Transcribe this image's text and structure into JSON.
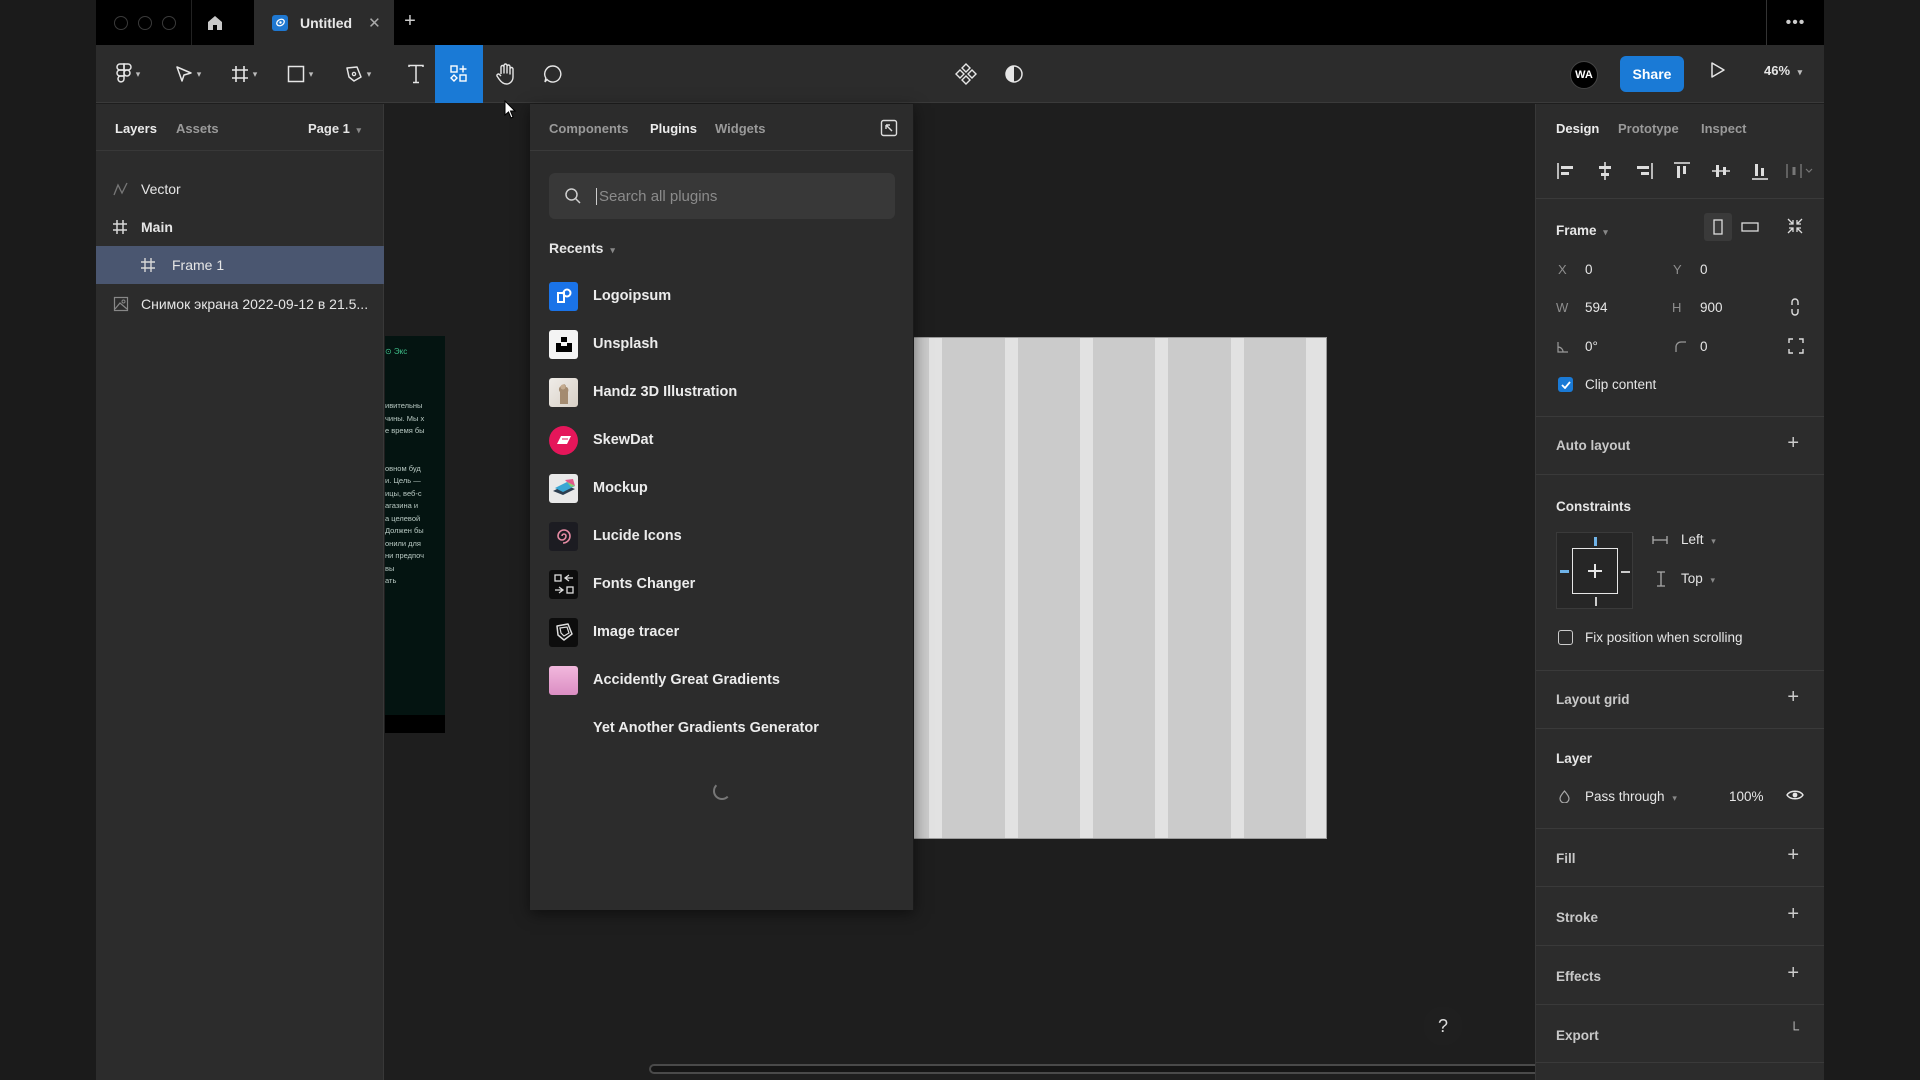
{
  "titlebar": {
    "tab_title": "Untitled",
    "close_symbol": "✕",
    "new_tab_symbol": "+",
    "more_symbol": "•••"
  },
  "toolbar": {
    "tools": [
      {
        "name": "main-menu",
        "icon": "figma-logo-icon",
        "has_dropdown": true
      },
      {
        "name": "move-tool",
        "icon": "cursor-icon",
        "has_dropdown": true
      },
      {
        "name": "frame-tool",
        "icon": "frame-icon",
        "has_dropdown": true
      },
      {
        "name": "shape-tool",
        "icon": "rectangle-icon",
        "has_dropdown": true
      },
      {
        "name": "pen-tool",
        "icon": "pen-icon",
        "has_dropdown": true
      },
      {
        "name": "text-tool",
        "icon": "text-icon",
        "has_dropdown": false
      },
      {
        "name": "resources-tool",
        "icon": "resources-icon",
        "active": true
      },
      {
        "name": "hand-tool",
        "icon": "hand-icon",
        "has_dropdown": false
      },
      {
        "name": "comment-tool",
        "icon": "comment-icon",
        "has_dropdown": false
      }
    ],
    "center_icons": [
      "component-icon",
      "contrast-icon"
    ],
    "avatar_initials": "WA",
    "share_label": "Share",
    "zoom_level": "46%",
    "accent_color": "#1a7ad6"
  },
  "left_panel": {
    "tabs": [
      "Layers",
      "Assets"
    ],
    "page_selector": "Page 1",
    "layers": [
      {
        "name": "Vector",
        "icon": "vector-icon",
        "indent": 0,
        "selected": false
      },
      {
        "name": "Main",
        "icon": "frame-icon",
        "indent": 0,
        "selected": false
      },
      {
        "name": "Frame 1",
        "icon": "frame-icon",
        "indent": 1,
        "selected": true
      },
      {
        "name": "Снимок экрана 2022-09-12 в 21.5...",
        "icon": "image-icon",
        "indent": 0,
        "selected": false
      }
    ]
  },
  "canvas": {
    "thumbnail_lines": [
      "ивительны",
      "чины. Мы х",
      "е время бы",
      "",
      "",
      "овном буд",
      "и. Цель —",
      "ицы, веб-с",
      "агазина и",
      "а целевой",
      "Должен бы",
      "онили для",
      "ни предпоч",
      "вы",
      "ать"
    ],
    "thumbnail_badge": "⊙ Экс",
    "frame_grid_columns": 6
  },
  "plugins_panel": {
    "tabs": [
      "Components",
      "Plugins",
      "Widgets"
    ],
    "active_tab": "Plugins",
    "search_placeholder": "Search all plugins",
    "search_value": "",
    "section_label": "Recents",
    "plugins": [
      {
        "name": "Logoipsum",
        "icon": "logoipsum-icon",
        "color": "#1a73e8"
      },
      {
        "name": "Unsplash",
        "icon": "unsplash-icon",
        "color": "#ffffff"
      },
      {
        "name": "Handz 3D Illustration",
        "icon": "handz-icon",
        "color": "#e8e4df"
      },
      {
        "name": "SkewDat",
        "icon": "skewdat-icon",
        "color": "#e5165a"
      },
      {
        "name": "Mockup",
        "icon": "mockup-icon",
        "color": "#e8e8e8"
      },
      {
        "name": "Lucide Icons",
        "icon": "lucide-icon",
        "color": "#1c1c22"
      },
      {
        "name": "Fonts Changer",
        "icon": "fonts-changer-icon",
        "color": "#0d0d0d"
      },
      {
        "name": "Image tracer",
        "icon": "image-tracer-icon",
        "color": "#0d0d0d"
      },
      {
        "name": "Accidently Great Gradients",
        "icon": "gradient-icon",
        "color": "#e6a3cf"
      },
      {
        "name": "Yet Another Gradients Generator",
        "icon": "gradients-generator-icon",
        "color": "#1a5fd6"
      }
    ]
  },
  "right_panel": {
    "tabs": [
      "Design",
      "Prototype",
      "Inspect"
    ],
    "active_tab": "Design",
    "frame": {
      "label": "Frame",
      "x_label": "X",
      "x": "0",
      "y_label": "Y",
      "y": "0",
      "w_label": "W",
      "w": "594",
      "h_label": "H",
      "h": "900",
      "rotation": "0°",
      "radius": "0",
      "clip_content_label": "Clip content",
      "clip_content": true
    },
    "auto_layout_label": "Auto layout",
    "constraints": {
      "label": "Constraints",
      "horizontal": "Left",
      "vertical": "Top",
      "fix_position_label": "Fix position when scrolling",
      "fix_position": false
    },
    "layout_grid_label": "Layout grid",
    "layer": {
      "label": "Layer",
      "blend_mode": "Pass through",
      "opacity": "100%"
    },
    "fill_label": "Fill",
    "stroke_label": "Stroke",
    "effects_label": "Effects",
    "export_label": "Export",
    "help_symbol": "?"
  }
}
